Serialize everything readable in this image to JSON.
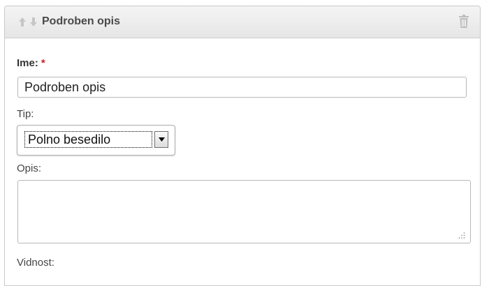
{
  "panel": {
    "title": "Podroben opis",
    "icons": [
      "arrow-up-icon",
      "arrow-down-icon",
      "trash-icon"
    ]
  },
  "form": {
    "name_label": "Ime:",
    "required_marker": "*",
    "name_value": "Podroben opis",
    "type_label": "Tip:",
    "type_selected": "Polno besedilo",
    "description_label": "Opis:",
    "description_value": "",
    "visibility_label": "Vidnost:"
  },
  "colors": {
    "header_bg": "#e9e9e9",
    "border": "#c9c9c9",
    "required": "#cc2222",
    "icon_gray": "#c4c4c4"
  }
}
